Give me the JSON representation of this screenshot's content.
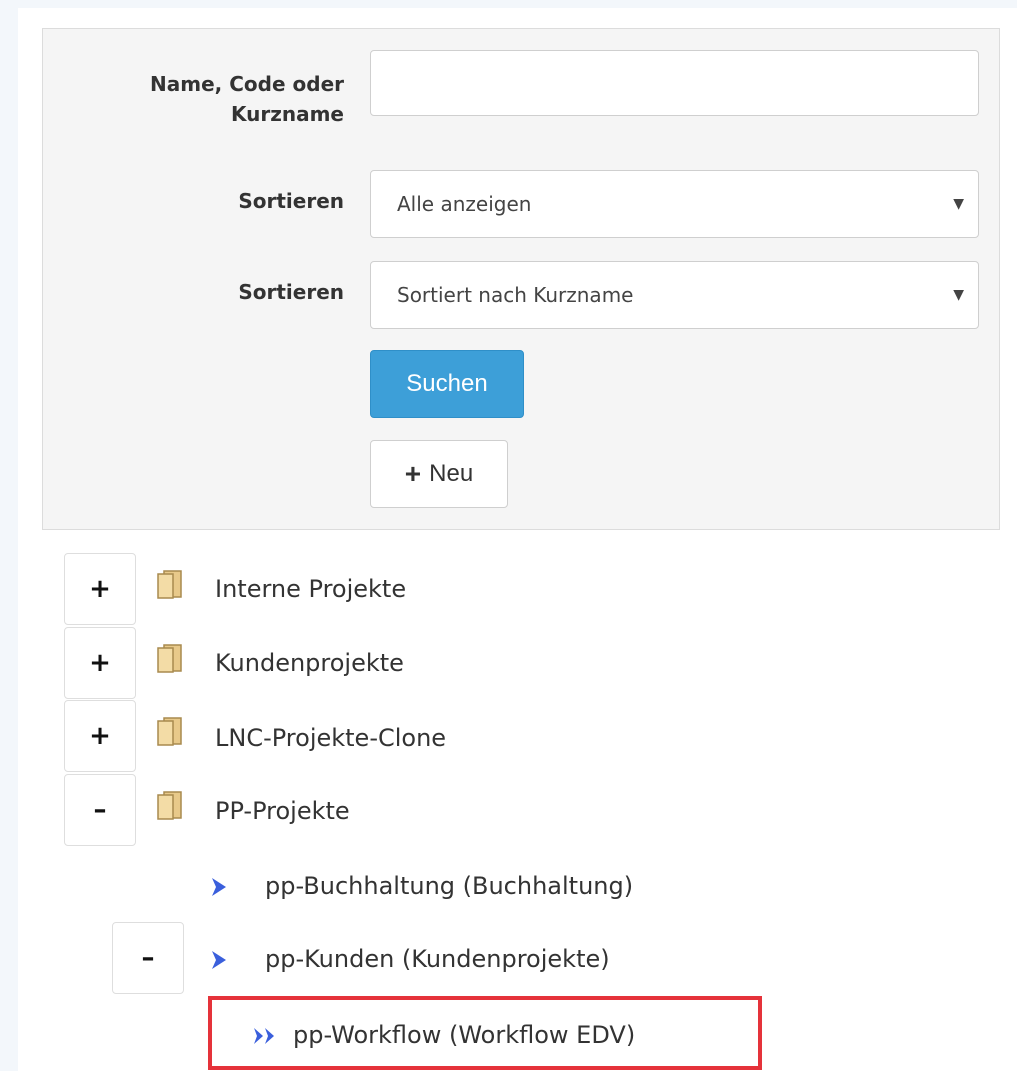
{
  "form": {
    "name_label": "Name, Code oder Kurzname",
    "name_value": "",
    "filter_label": "Sortieren",
    "filter_value": "Alle anzeigen",
    "sort_label": "Sortieren",
    "sort_value": "Sortiert nach Kurzname",
    "search_button": "Suchen",
    "new_button": "Neu"
  },
  "tree": {
    "items": [
      {
        "label": "Interne Projekte",
        "toggle": "+",
        "icon": "folder-icon"
      },
      {
        "label": "Kundenprojekte",
        "toggle": "+",
        "icon": "folder-icon"
      },
      {
        "label": "LNC-Projekte-Clone",
        "toggle": "+",
        "icon": "folder-icon"
      },
      {
        "label": "PP-Projekte",
        "toggle": "–",
        "icon": "folder-icon"
      },
      {
        "label": "pp-Buchhaltung (Buchhaltung)",
        "icon": "chevron-right-icon"
      },
      {
        "label": "pp-Kunden (Kundenprojekte)",
        "toggle": "–",
        "icon": "chevron-right-icon"
      },
      {
        "label": "pp-Workflow (Workflow EDV)",
        "icon": "double-chevron-right-icon"
      }
    ]
  },
  "colors": {
    "primary_button": "#3d9fd8",
    "highlight": "#e5323a",
    "chevron": "#3a5fdc"
  }
}
